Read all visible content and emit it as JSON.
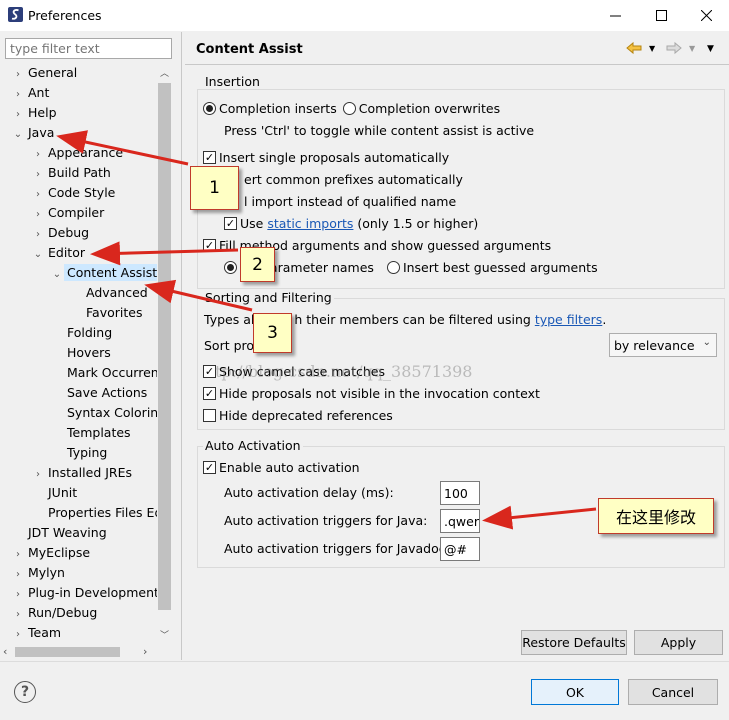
{
  "window": {
    "title": "Preferences"
  },
  "colors": {
    "selection": "#cde8ff",
    "link": "#1a58b5",
    "annotation_bg": "#ffffc4",
    "arrow": "#d9271d"
  },
  "filter": {
    "placeholder": "type filter text"
  },
  "tree": [
    {
      "label": "General",
      "chev": "›",
      "name": "tree-item-general"
    },
    {
      "label": "Ant",
      "chev": "›",
      "name": "tree-item-ant"
    },
    {
      "label": "Help",
      "chev": "›",
      "name": "tree-item-help"
    },
    {
      "label": "Java",
      "chev": "⌄",
      "name": "tree-item-java"
    },
    {
      "label": "Appearance",
      "chev": "›",
      "name": "tree-item-appearance"
    },
    {
      "label": "Build Path",
      "chev": "›",
      "name": "tree-item-build-path"
    },
    {
      "label": "Code Style",
      "chev": "›",
      "name": "tree-item-code-style"
    },
    {
      "label": "Compiler",
      "chev": "›",
      "name": "tree-item-compiler"
    },
    {
      "label": "Debug",
      "chev": "›",
      "name": "tree-item-debug"
    },
    {
      "label": "Editor",
      "chev": "⌄",
      "name": "tree-item-editor"
    },
    {
      "label": "Content Assist",
      "chev": "⌄",
      "name": "tree-item-content-assist"
    },
    {
      "label": "Advanced",
      "chev": "",
      "name": "tree-item-advanced"
    },
    {
      "label": "Favorites",
      "chev": "",
      "name": "tree-item-favorites"
    },
    {
      "label": "Folding",
      "chev": "",
      "name": "tree-item-folding"
    },
    {
      "label": "Hovers",
      "chev": "",
      "name": "tree-item-hovers"
    },
    {
      "label": "Mark Occurren",
      "chev": "",
      "name": "tree-item-mark-occurrences"
    },
    {
      "label": "Save Actions",
      "chev": "",
      "name": "tree-item-save-actions"
    },
    {
      "label": "Syntax Coloring",
      "chev": "",
      "name": "tree-item-syntax-coloring"
    },
    {
      "label": "Templates",
      "chev": "",
      "name": "tree-item-templates"
    },
    {
      "label": "Typing",
      "chev": "",
      "name": "tree-item-typing"
    },
    {
      "label": "Installed JREs",
      "chev": "›",
      "name": "tree-item-installed-jres"
    },
    {
      "label": "JUnit",
      "chev": "",
      "name": "tree-item-junit"
    },
    {
      "label": "Properties Files Ed",
      "chev": "",
      "name": "tree-item-properties-files"
    },
    {
      "label": "JDT Weaving",
      "chev": "",
      "name": "tree-item-jdt-weaving"
    },
    {
      "label": "MyEclipse",
      "chev": "›",
      "name": "tree-item-myeclipse"
    },
    {
      "label": "Mylyn",
      "chev": "›",
      "name": "tree-item-mylyn"
    },
    {
      "label": "Plug-in Development",
      "chev": "›",
      "name": "tree-item-plugin-development"
    },
    {
      "label": "Run/Debug",
      "chev": "›",
      "name": "tree-item-run-debug"
    },
    {
      "label": "Team",
      "chev": "›",
      "name": "tree-item-team"
    }
  ],
  "page": {
    "title": "Content Assist",
    "insertion": {
      "label": "Insertion",
      "completion_inserts": "Completion inserts",
      "completion_overwrites": "Completion overwrites",
      "toggle_hint": "Press 'Ctrl' to toggle while content assist is active",
      "insert_single": "Insert single proposals automatically",
      "insert_prefixes": "ert common prefixes automatically",
      "add_import": "l import instead of qualified name",
      "use": "Use",
      "static_imports": "static imports",
      "only_15": "(only 1.5 or higher)",
      "fill_method": "Fill method arguments and show guessed arguments",
      "param_names": "parameter names",
      "best_guessed": "Insert best guessed arguments"
    },
    "sorting": {
      "label": "Sorting and Filtering",
      "types_prefix": "Types al",
      "types_suffix": "h their members can be filtered using",
      "type_filters": "type filters",
      "period": ".",
      "sort_label": "Sort pro",
      "sort_value": "by relevance",
      "show_camel": "Show camel case matches",
      "hide_not_visible": "Hide proposals not visible in the invocation context",
      "hide_deprecated": "Hide deprecated references"
    },
    "auto": {
      "label": "Auto Activation",
      "enable": "Enable auto activation",
      "delay_label": "Auto activation delay (ms):",
      "delay_value": "100",
      "java_label": "Auto activation triggers for Java:",
      "java_value": ".qwer",
      "javadoc_label": "Auto activation triggers for Javadoc:",
      "javadoc_value": "@#"
    },
    "restore_defaults": "Restore Defaults",
    "apply": "Apply"
  },
  "footer": {
    "ok": "OK",
    "cancel": "Cancel",
    "help": "?"
  },
  "annotations": {
    "one": "1",
    "two": "2",
    "three": "3",
    "modify_here": "在这里修改",
    "watermark": "tp://blog.csdn.net/qq_38571398"
  }
}
